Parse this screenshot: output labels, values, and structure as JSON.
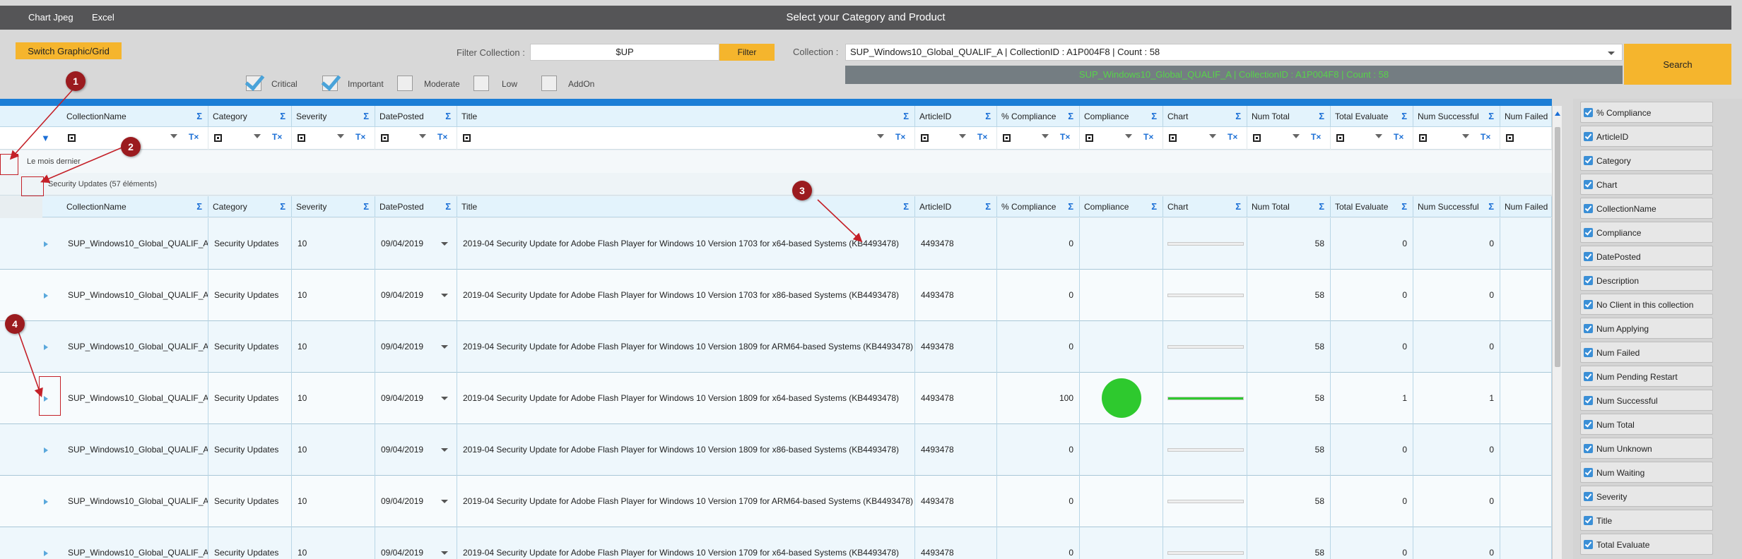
{
  "topbar": {
    "menu": [
      "Chart Jpeg",
      "Excel"
    ],
    "title": "Select your Category and Product"
  },
  "toolbar": {
    "switch_label": "Switch Graphic/Grid",
    "filter_collection_label": "Filter Collection :",
    "filter_value": "$UP",
    "filter_button": "Filter",
    "collection_label": "Collection :",
    "collection_value": "SUP_Windows10_Global_QUALIF_A  | CollectionID : A1P004F8 | Count : 58",
    "collection_banner": "SUP_Windows10_Global_QUALIF_A  | CollectionID : A1P004F8 | Count : 58",
    "search_button": "Search",
    "severity_filters": [
      {
        "label": "Critical",
        "checked": true
      },
      {
        "label": "Important",
        "checked": true
      },
      {
        "label": "Moderate",
        "checked": false
      },
      {
        "label": "Low",
        "checked": false
      },
      {
        "label": "AddOn",
        "checked": false
      }
    ]
  },
  "grid": {
    "columns": [
      "CollectionName",
      "Category",
      "Severity",
      "DatePosted",
      "Title",
      "ArticleID",
      "% Compliance",
      "Compliance",
      "Chart",
      "Num Total",
      "Total Evaluate",
      "Num Successful",
      "Num Failed"
    ],
    "group_level1": "Le mois dernier",
    "group_level2": "Security Updates (57 éléments)",
    "rows": [
      {
        "collection": "SUP_Windows10_Global_QUALIF_A",
        "category": "Security Updates",
        "severity": "10",
        "date": "09/04/2019",
        "title": "2019-04 Security Update for Adobe Flash Player for Windows 10 Version 1703 for x64-based Systems (KB4493478)",
        "article": "4493478",
        "pct": "0",
        "compliance_pct": 0,
        "total": "58",
        "evaluate": "0",
        "successful": "0"
      },
      {
        "collection": "SUP_Windows10_Global_QUALIF_A",
        "category": "Security Updates",
        "severity": "10",
        "date": "09/04/2019",
        "title": "2019-04 Security Update for Adobe Flash Player for Windows 10 Version 1703 for x86-based Systems (KB4493478)",
        "article": "4493478",
        "pct": "0",
        "compliance_pct": 0,
        "total": "58",
        "evaluate": "0",
        "successful": "0"
      },
      {
        "collection": "SUP_Windows10_Global_QUALIF_A",
        "category": "Security Updates",
        "severity": "10",
        "date": "09/04/2019",
        "title": "2019-04 Security Update for Adobe Flash Player for Windows 10 Version 1809 for ARM64-based Systems (KB4493478)",
        "article": "4493478",
        "pct": "0",
        "compliance_pct": 0,
        "total": "58",
        "evaluate": "0",
        "successful": "0"
      },
      {
        "collection": "SUP_Windows10_Global_QUALIF_A",
        "category": "Security Updates",
        "severity": "10",
        "date": "09/04/2019",
        "title": "2019-04 Security Update for Adobe Flash Player for Windows 10 Version 1809 for x64-based Systems (KB4493478)",
        "article": "4493478",
        "pct": "100",
        "compliance_pct": 100,
        "total": "58",
        "evaluate": "1",
        "successful": "1"
      },
      {
        "collection": "SUP_Windows10_Global_QUALIF_A",
        "category": "Security Updates",
        "severity": "10",
        "date": "09/04/2019",
        "title": "2019-04 Security Update for Adobe Flash Player for Windows 10 Version 1809 for x86-based Systems (KB4493478)",
        "article": "4493478",
        "pct": "0",
        "compliance_pct": 0,
        "total": "58",
        "evaluate": "0",
        "successful": "0"
      },
      {
        "collection": "SUP_Windows10_Global_QUALIF_A",
        "category": "Security Updates",
        "severity": "10",
        "date": "09/04/2019",
        "title": "2019-04 Security Update for Adobe Flash Player for Windows 10 Version 1709 for ARM64-based Systems (KB4493478)",
        "article": "4493478",
        "pct": "0",
        "compliance_pct": 0,
        "total": "58",
        "evaluate": "0",
        "successful": "0"
      },
      {
        "collection": "SUP_Windows10_Global_QUALIF_A",
        "category": "Security Updates",
        "severity": "10",
        "date": "09/04/2019",
        "title": "2019-04 Security Update for Adobe Flash Player for Windows 10 Version 1709 for x64-based Systems (KB4493478)",
        "article": "4493478",
        "pct": "0",
        "compliance_pct": 0,
        "total": "58",
        "evaluate": "0",
        "successful": "0"
      }
    ]
  },
  "column_chooser": [
    "% Compliance",
    "ArticleID",
    "Category",
    "Chart",
    "CollectionName",
    "Compliance",
    "DatePosted",
    "Description",
    "No Client in this collection",
    "Num Applying",
    "Num Failed",
    "Num Pending Restart",
    "Num Successful",
    "Num Total",
    "Num Unknown",
    "Num Waiting",
    "Severity",
    "Title",
    "Total Evaluate"
  ],
  "annotations": [
    "1",
    "2",
    "3",
    "4"
  ],
  "colors": {
    "accent": "#1b7ed6",
    "button": "#f5b52d",
    "success": "#2ec92e",
    "annotation": "#9b1b1f"
  }
}
